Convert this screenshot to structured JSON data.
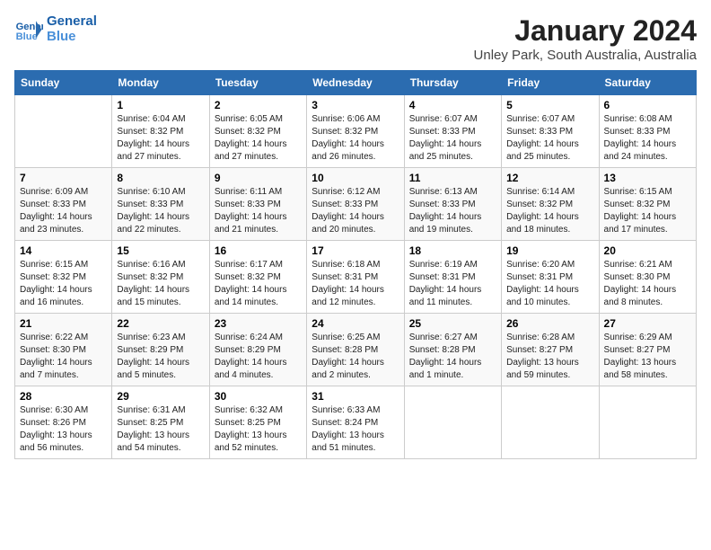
{
  "header": {
    "logo_line1": "General",
    "logo_line2": "Blue",
    "month_title": "January 2024",
    "location": "Unley Park, South Australia, Australia"
  },
  "calendar": {
    "days_of_week": [
      "Sunday",
      "Monday",
      "Tuesday",
      "Wednesday",
      "Thursday",
      "Friday",
      "Saturday"
    ],
    "weeks": [
      [
        {
          "day": "",
          "content": ""
        },
        {
          "day": "1",
          "content": "Sunrise: 6:04 AM\nSunset: 8:32 PM\nDaylight: 14 hours\nand 27 minutes."
        },
        {
          "day": "2",
          "content": "Sunrise: 6:05 AM\nSunset: 8:32 PM\nDaylight: 14 hours\nand 27 minutes."
        },
        {
          "day": "3",
          "content": "Sunrise: 6:06 AM\nSunset: 8:32 PM\nDaylight: 14 hours\nand 26 minutes."
        },
        {
          "day": "4",
          "content": "Sunrise: 6:07 AM\nSunset: 8:33 PM\nDaylight: 14 hours\nand 25 minutes."
        },
        {
          "day": "5",
          "content": "Sunrise: 6:07 AM\nSunset: 8:33 PM\nDaylight: 14 hours\nand 25 minutes."
        },
        {
          "day": "6",
          "content": "Sunrise: 6:08 AM\nSunset: 8:33 PM\nDaylight: 14 hours\nand 24 minutes."
        }
      ],
      [
        {
          "day": "7",
          "content": "Sunrise: 6:09 AM\nSunset: 8:33 PM\nDaylight: 14 hours\nand 23 minutes."
        },
        {
          "day": "8",
          "content": "Sunrise: 6:10 AM\nSunset: 8:33 PM\nDaylight: 14 hours\nand 22 minutes."
        },
        {
          "day": "9",
          "content": "Sunrise: 6:11 AM\nSunset: 8:33 PM\nDaylight: 14 hours\nand 21 minutes."
        },
        {
          "day": "10",
          "content": "Sunrise: 6:12 AM\nSunset: 8:33 PM\nDaylight: 14 hours\nand 20 minutes."
        },
        {
          "day": "11",
          "content": "Sunrise: 6:13 AM\nSunset: 8:33 PM\nDaylight: 14 hours\nand 19 minutes."
        },
        {
          "day": "12",
          "content": "Sunrise: 6:14 AM\nSunset: 8:32 PM\nDaylight: 14 hours\nand 18 minutes."
        },
        {
          "day": "13",
          "content": "Sunrise: 6:15 AM\nSunset: 8:32 PM\nDaylight: 14 hours\nand 17 minutes."
        }
      ],
      [
        {
          "day": "14",
          "content": "Sunrise: 6:15 AM\nSunset: 8:32 PM\nDaylight: 14 hours\nand 16 minutes."
        },
        {
          "day": "15",
          "content": "Sunrise: 6:16 AM\nSunset: 8:32 PM\nDaylight: 14 hours\nand 15 minutes."
        },
        {
          "day": "16",
          "content": "Sunrise: 6:17 AM\nSunset: 8:32 PM\nDaylight: 14 hours\nand 14 minutes."
        },
        {
          "day": "17",
          "content": "Sunrise: 6:18 AM\nSunset: 8:31 PM\nDaylight: 14 hours\nand 12 minutes."
        },
        {
          "day": "18",
          "content": "Sunrise: 6:19 AM\nSunset: 8:31 PM\nDaylight: 14 hours\nand 11 minutes."
        },
        {
          "day": "19",
          "content": "Sunrise: 6:20 AM\nSunset: 8:31 PM\nDaylight: 14 hours\nand 10 minutes."
        },
        {
          "day": "20",
          "content": "Sunrise: 6:21 AM\nSunset: 8:30 PM\nDaylight: 14 hours\nand 8 minutes."
        }
      ],
      [
        {
          "day": "21",
          "content": "Sunrise: 6:22 AM\nSunset: 8:30 PM\nDaylight: 14 hours\nand 7 minutes."
        },
        {
          "day": "22",
          "content": "Sunrise: 6:23 AM\nSunset: 8:29 PM\nDaylight: 14 hours\nand 5 minutes."
        },
        {
          "day": "23",
          "content": "Sunrise: 6:24 AM\nSunset: 8:29 PM\nDaylight: 14 hours\nand 4 minutes."
        },
        {
          "day": "24",
          "content": "Sunrise: 6:25 AM\nSunset: 8:28 PM\nDaylight: 14 hours\nand 2 minutes."
        },
        {
          "day": "25",
          "content": "Sunrise: 6:27 AM\nSunset: 8:28 PM\nDaylight: 14 hours\nand 1 minute."
        },
        {
          "day": "26",
          "content": "Sunrise: 6:28 AM\nSunset: 8:27 PM\nDaylight: 13 hours\nand 59 minutes."
        },
        {
          "day": "27",
          "content": "Sunrise: 6:29 AM\nSunset: 8:27 PM\nDaylight: 13 hours\nand 58 minutes."
        }
      ],
      [
        {
          "day": "28",
          "content": "Sunrise: 6:30 AM\nSunset: 8:26 PM\nDaylight: 13 hours\nand 56 minutes."
        },
        {
          "day": "29",
          "content": "Sunrise: 6:31 AM\nSunset: 8:25 PM\nDaylight: 13 hours\nand 54 minutes."
        },
        {
          "day": "30",
          "content": "Sunrise: 6:32 AM\nSunset: 8:25 PM\nDaylight: 13 hours\nand 52 minutes."
        },
        {
          "day": "31",
          "content": "Sunrise: 6:33 AM\nSunset: 8:24 PM\nDaylight: 13 hours\nand 51 minutes."
        },
        {
          "day": "",
          "content": ""
        },
        {
          "day": "",
          "content": ""
        },
        {
          "day": "",
          "content": ""
        }
      ]
    ]
  }
}
